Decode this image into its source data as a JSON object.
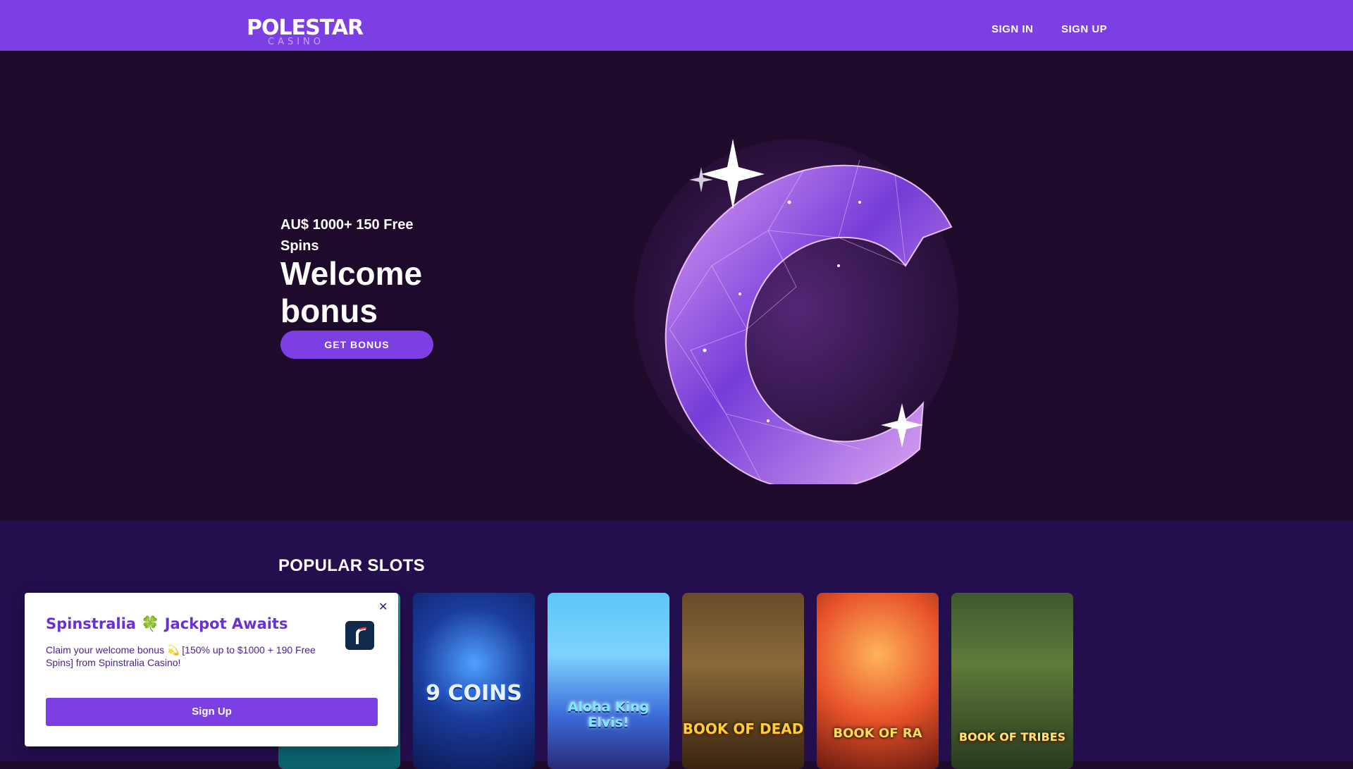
{
  "header": {
    "logo_main": "POLESTAR",
    "logo_sub": "CASINO",
    "nav": {
      "sign_in": "SIGN IN",
      "sign_up": "SIGN UP"
    }
  },
  "hero": {
    "subtitle": "AU$ 1000+ 150 Free Spins",
    "title": "Welcome bonus",
    "button_label": "GET BONUS",
    "art_icon": "crystal-c-logo"
  },
  "popular": {
    "title": "POPULAR SLOTS",
    "games": [
      {
        "name": ""
      },
      {
        "name": "9 COINS"
      },
      {
        "name": "Aloha King Elvis!"
      },
      {
        "name": "BOOK OF DEAD"
      },
      {
        "name": "BOOK OF RA"
      },
      {
        "name": "BOOK OF TRIBES"
      }
    ]
  },
  "popup": {
    "title": "Spinstralia 🍀 Jackpot Awaits",
    "text": "Claim your welcome bonus 💫 [150% up to $1000 + 190 Free Spins] from Spinstralia Casino!",
    "button_label": "Sign Up",
    "close_icon": "close-icon"
  },
  "colors": {
    "brand_purple": "#7b3fe4",
    "hero_bg": "#1e0a2b",
    "section_bg": "#230f4e"
  }
}
